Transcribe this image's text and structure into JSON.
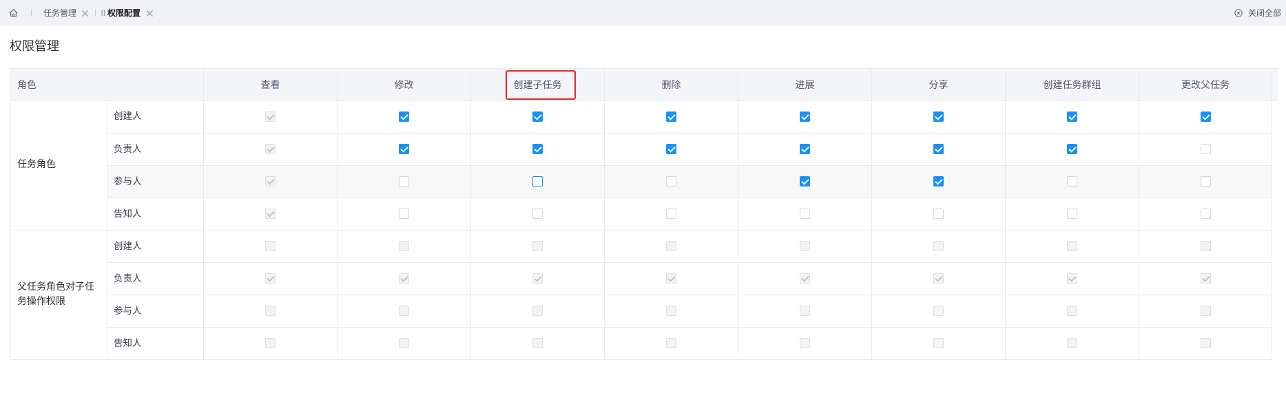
{
  "tabs": {
    "items": [
      {
        "label": "任务管理",
        "active": false
      },
      {
        "label": "权限配置",
        "active": true
      }
    ],
    "close_all": "关闭全部"
  },
  "icons": {
    "home": "home-icon",
    "tab_close": "close-icon",
    "drag": "drag-handle-icon",
    "close_all": "close-circle-icon",
    "checkbox_mark": "check-icon"
  },
  "page": {
    "title": "权限管理"
  },
  "table": {
    "role_header": "角色",
    "columns": [
      {
        "label": "查看"
      },
      {
        "label": "修改"
      },
      {
        "label": "创建子任务",
        "highlighted": true
      },
      {
        "label": "删除"
      },
      {
        "label": "进展"
      },
      {
        "label": "分享"
      },
      {
        "label": "创建任务群组"
      },
      {
        "label": "更改父任务"
      }
    ],
    "groups": [
      {
        "name": "任务角色",
        "rows": [
          {
            "role": "创建人",
            "checked": [
              true,
              true,
              true,
              true,
              true,
              true,
              true,
              true
            ],
            "disabled": [
              true,
              false,
              false,
              false,
              false,
              false,
              false,
              false
            ]
          },
          {
            "role": "负责人",
            "checked": [
              true,
              true,
              true,
              true,
              true,
              true,
              true,
              false
            ],
            "disabled": [
              true,
              false,
              false,
              false,
              false,
              false,
              false,
              false
            ]
          },
          {
            "role": "参与人",
            "hovered": true,
            "checked": [
              true,
              false,
              false,
              false,
              true,
              true,
              false,
              false
            ],
            "disabled": [
              true,
              false,
              false,
              false,
              false,
              false,
              false,
              false
            ],
            "focused": [
              false,
              false,
              true,
              false,
              false,
              false,
              false,
              false
            ]
          },
          {
            "role": "告知人",
            "checked": [
              true,
              false,
              false,
              false,
              false,
              false,
              false,
              false
            ],
            "disabled": [
              true,
              false,
              false,
              false,
              false,
              false,
              false,
              false
            ]
          }
        ]
      },
      {
        "name": "父任务角色对子任务操作权限",
        "rows": [
          {
            "role": "创建人",
            "checked": [
              false,
              false,
              false,
              false,
              false,
              false,
              false,
              false
            ],
            "disabled": [
              true,
              true,
              true,
              true,
              true,
              true,
              true,
              true
            ]
          },
          {
            "role": "负责人",
            "checked": [
              true,
              true,
              true,
              true,
              true,
              true,
              true,
              true
            ],
            "disabled": [
              true,
              true,
              true,
              true,
              true,
              true,
              true,
              true
            ]
          },
          {
            "role": "参与人",
            "checked": [
              false,
              false,
              false,
              false,
              false,
              false,
              false,
              false
            ],
            "disabled": [
              true,
              true,
              true,
              true,
              true,
              true,
              true,
              true
            ]
          },
          {
            "role": "告知人",
            "checked": [
              false,
              false,
              false,
              false,
              false,
              false,
              false,
              false
            ],
            "disabled": [
              true,
              true,
              true,
              true,
              true,
              true,
              true,
              true
            ]
          }
        ]
      }
    ]
  },
  "colors": {
    "accent": "#1890ff",
    "highlight": "#e32a2a",
    "tabbar_bg": "#f0f2f5",
    "header_bg": "#f3f5f9",
    "border": "#e8eaec",
    "hover_row_bg": "#f8f8f9",
    "disabled_bg": "#f3f3f3",
    "text": "#333333"
  }
}
